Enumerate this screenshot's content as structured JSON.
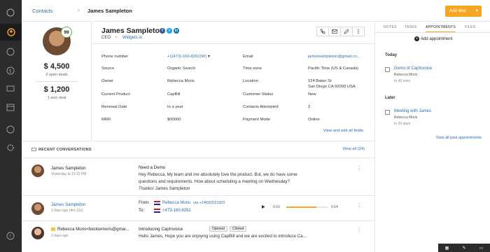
{
  "breadcrumb": {
    "root": "Contacts",
    "current": "James Sampleton"
  },
  "toolbar": {
    "add_deal_label": "Add deal"
  },
  "contact": {
    "name": "James Sampleton",
    "role": "CEO",
    "company": "Widgets.io",
    "score": "99",
    "open_deals_value": "$ 4,500",
    "open_deals_label": "2 open deals",
    "won_deals_value": "$ 1,200",
    "won_deals_label": "1 won deal"
  },
  "fields": {
    "phone_label": "Phone number",
    "phone_value": "+1(473)-160-8261(W)",
    "source_label": "Source",
    "source_value": "Organic Search",
    "owner_label": "Owner",
    "owner_value": "Rebecca Moris",
    "product_label": "Current Product",
    "product_value": "CapBill",
    "renewal_label": "Renewal Date",
    "renewal_value": "In a year",
    "mrr_label": "MRR",
    "mrr_value": "$00000",
    "email_label": "Email",
    "email_value": "jamessampleton@gmail.co...",
    "timezone_label": "Time zone",
    "timezone_value": "Pacific Time (US & Canada)",
    "location_label": "Location",
    "location_line1": "124 Baker St",
    "location_line2": "San Diego CA 92093 USA",
    "status_label": "Customer Status",
    "status_value": "New",
    "attempted_label": "Contacts Attempted",
    "attempted_value": "2",
    "payment_label": "Payment Mode",
    "payment_value": "Online",
    "view_all": "View and edit all fields"
  },
  "conversations": {
    "title": "RECENT CONVERSATIONS",
    "view_all": "View all (24)",
    "rows": [
      {
        "name": "James Sampleton",
        "meta": "Yesterday at 12:32 PM",
        "subject": "Need a Demo",
        "body1": "Hey Rebecca, My team and me absolutely love the product. But, we do have some",
        "body2": "questions and requirements. How about scheduling a meeting on Wednesday?",
        "body3": "Thanks! James Sampleton"
      },
      {
        "name": "James Sampleton",
        "meta": "2 days ago (4m 12s)",
        "from_label": "From:",
        "from_name": "Rebecca Moris",
        "from_number": "via +14692511923",
        "to_label": "To:",
        "to_number": "+473-160-8261",
        "time_start": "0:10",
        "time_end": "0:14",
        "progress": 0.72
      },
      {
        "name": "Rebecca Moris<beckiemoris@gmai...",
        "meta": "2 days ago",
        "subject": "Introducing CapInvoice",
        "chip1": "Opened",
        "chip2": "Clicked",
        "body1": "Hello James, Hope you are enjoying using CapBill and we are excited to introduce Ca..."
      }
    ]
  },
  "right_panel": {
    "tabs": [
      "NOTES",
      "TASKS",
      "APPOINTMENTS",
      "FILES"
    ],
    "active_tab": "APPOINTMENTS",
    "add_label": "Add appointment",
    "today_label": "Today",
    "later_label": "Later",
    "appts": [
      {
        "title": "Demo of CapInvoice",
        "owner": "Rebecca Moris",
        "time": "In 45 mins"
      },
      {
        "title": "Meeting with James",
        "owner": "Rebecca Moris",
        "time": "In 20 days"
      }
    ],
    "view_past": "View all past appointments"
  },
  "colors": {
    "accent": "#f5a623",
    "link": "#2b6cb0",
    "sidebar": "#2c2c2c",
    "score": "#58b947"
  }
}
